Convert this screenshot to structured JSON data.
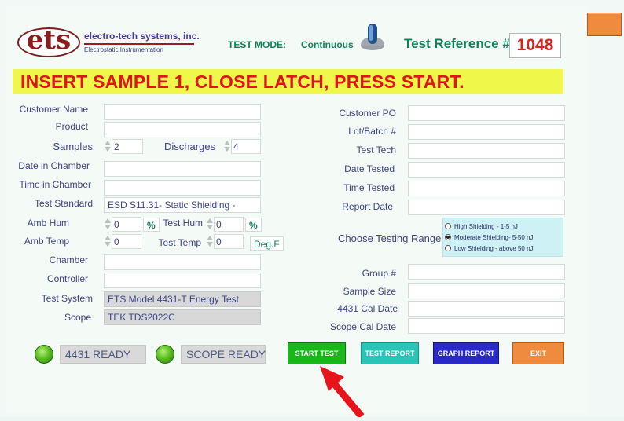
{
  "header": {
    "logo_text": "ets",
    "company_name": "electro-tech systems, inc.",
    "company_tagline": "Electrostatic Instrumentation",
    "test_mode_label": "TEST MODE:",
    "test_mode_value": "Continuous",
    "test_ref_label": "Test Reference #",
    "test_ref_value": "1048"
  },
  "banner": {
    "message": "INSERT SAMPLE 1, CLOSE LATCH, PRESS START."
  },
  "left_form": {
    "customer_name_label": "Customer Name",
    "customer_name_value": "",
    "product_label": "Product",
    "product_value": "",
    "samples_label": "Samples",
    "samples_value": "2",
    "discharges_label": "Discharges",
    "discharges_value": "4",
    "date_in_chamber_label": "Date in Chamber",
    "date_in_chamber_value": "",
    "time_in_chamber_label": "Time in Chamber",
    "time_in_chamber_value": "",
    "test_standard_label": "Test Standard",
    "test_standard_value": "ESD S11.31- Static Shielding -",
    "amb_hum_label": "Amb Hum",
    "amb_hum_value": "0",
    "amb_hum_unit": "%",
    "test_hum_label": "Test Hum",
    "test_hum_value": "0",
    "test_hum_unit": "%",
    "amb_temp_label": "Amb Temp",
    "amb_temp_value": "0",
    "test_temp_label": "Test Temp",
    "test_temp_value": "0",
    "temp_unit": "Deg.F",
    "chamber_label": "Chamber",
    "chamber_value": "",
    "controller_label": "Controller",
    "controller_value": "",
    "test_system_label": "Test System",
    "test_system_value": "ETS Model 4431-T Energy Test",
    "scope_label": "Scope",
    "scope_value": "TEK TDS2022C"
  },
  "right_form": {
    "customer_po_label": "Customer PO",
    "customer_po_value": "",
    "lot_batch_label": "Lot/Batch #",
    "lot_batch_value": "",
    "test_tech_label": "Test Tech",
    "test_tech_value": "",
    "date_tested_label": "Date Tested",
    "date_tested_value": "",
    "time_tested_label": "Time Tested",
    "time_tested_value": "",
    "report_date_label": "Report Date",
    "report_date_value": "",
    "range_label": "Choose Testing Range",
    "range_options": [
      {
        "label": "High Shielding - 1-5 nJ",
        "selected": false
      },
      {
        "label": "Moderate Shielding-  5-50 nJ",
        "selected": true
      },
      {
        "label": "Low Shielding  -  above 50 nJ",
        "selected": false
      }
    ],
    "group_label": "Group #",
    "group_value": "",
    "sample_size_label": "Sample Size",
    "sample_size_value": "",
    "cal_date_label": "4431 Cal Date",
    "cal_date_value": "",
    "scope_cal_label": "Scope Cal Date",
    "scope_cal_value": ""
  },
  "status": {
    "device_ready": "4431 READY",
    "scope_ready": "SCOPE READY"
  },
  "buttons": {
    "start": "START TEST",
    "report": "TEST REPORT",
    "graph": "GRAPH REPORT",
    "exit": "EXIT"
  },
  "colors": {
    "banner_bg": "#eef74a",
    "banner_text": "#e0141b",
    "start_btn": "#18b81a",
    "report_btn": "#2bc5b8",
    "graph_btn": "#2a2ac8",
    "exit_btn": "#f08a3c",
    "ref_number": "#e02020",
    "arrow": "#e8141b"
  },
  "icons": {
    "toggle": "toggle-switch-icon",
    "led": "green-led-icon",
    "arrow": "red-pointer-arrow-icon"
  }
}
